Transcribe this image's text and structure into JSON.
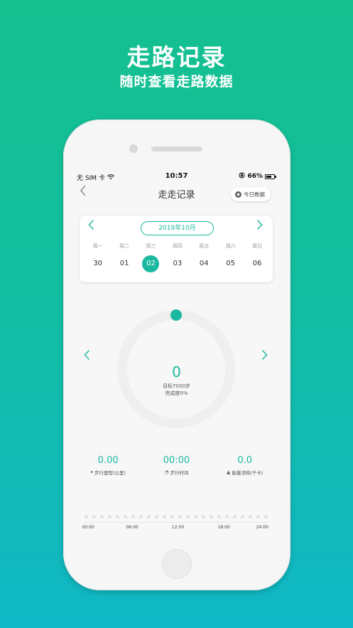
{
  "promo": {
    "title": "走路记录",
    "subtitle": "随时查看走路数据"
  },
  "status_bar": {
    "carrier": "无 SIM 卡",
    "time": "10:57",
    "battery": "66%"
  },
  "nav": {
    "title": "走走记录",
    "today_button": "今日数据"
  },
  "calendar": {
    "month": "2019年10月",
    "weekdays": [
      "周一",
      "周二",
      "周三",
      "周四",
      "周五",
      "周六",
      "周日"
    ],
    "dates": [
      "30",
      "01",
      "02",
      "03",
      "04",
      "05",
      "06"
    ],
    "selected_index": 2
  },
  "progress": {
    "steps": "0",
    "goal": "目标7000步",
    "completion": "完成度0%",
    "completion_fraction": 0
  },
  "stats": [
    {
      "value": "0.00",
      "label": "步行里程(公里)",
      "icon": "trophy-icon"
    },
    {
      "value": "00:00",
      "label": "步行时间",
      "icon": "clock-icon"
    },
    {
      "value": "0.0",
      "label": "能量消耗(千卡)",
      "icon": "flame-icon"
    }
  ],
  "timeline": {
    "ticks": [
      "00:00",
      "06:00",
      "12:00",
      "18:00",
      "24:00"
    ]
  },
  "colors": {
    "accent": "#1bb9a0",
    "ring_track": "#efefef"
  }
}
